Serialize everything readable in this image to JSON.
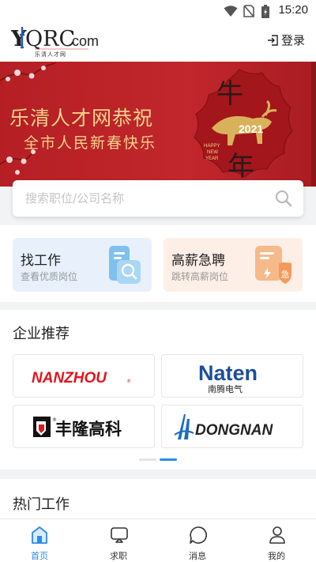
{
  "status_bar": {
    "time": "15:20",
    "icons": [
      "wifi-icon",
      "sim-icon",
      "battery-icon"
    ]
  },
  "header": {
    "logo_text": "YQRC.com",
    "logo_subtitle": "乐清人才网",
    "login_label": "登录"
  },
  "banner": {
    "title": "乐清人才网恭祝",
    "subtitle": "全市人民新春快乐",
    "badge_char1": "牛",
    "badge_char2": "年",
    "badge_year": "2021",
    "badge_greeting_1": "HAPPY",
    "badge_greeting_2": "NEW",
    "badge_greeting_3": "YEAR"
  },
  "search": {
    "placeholder": "搜索职位/公司名称"
  },
  "quick_actions": [
    {
      "title": "找工作",
      "subtitle": "查看优质岗位",
      "icon": "job-search-icon"
    },
    {
      "title": "高薪急聘",
      "subtitle": "跳转高薪岗位",
      "icon": "urgent-hire-icon",
      "badge": "急"
    }
  ],
  "companies": {
    "heading": "企业推荐",
    "items": [
      {
        "name": "NANZHOU",
        "suffix": "®"
      },
      {
        "name": "Naten",
        "subname": "南腾电气"
      },
      {
        "name": "丰隆高科",
        "mark": "®"
      },
      {
        "name": "DONGNAN"
      }
    ],
    "page_indicator": {
      "pages": 2,
      "active": 2
    }
  },
  "hot_jobs": {
    "heading": "热门工作"
  },
  "tabbar": [
    {
      "label": "首页",
      "icon": "home-icon",
      "active": true
    },
    {
      "label": "求职",
      "icon": "job-icon",
      "active": false
    },
    {
      "label": "消息",
      "icon": "message-icon",
      "active": false
    },
    {
      "label": "我的",
      "icon": "profile-icon",
      "active": false
    }
  ],
  "colors": {
    "accent": "#2b8be6",
    "banner_red": "#c1272d",
    "gold": "#f3d38a"
  }
}
